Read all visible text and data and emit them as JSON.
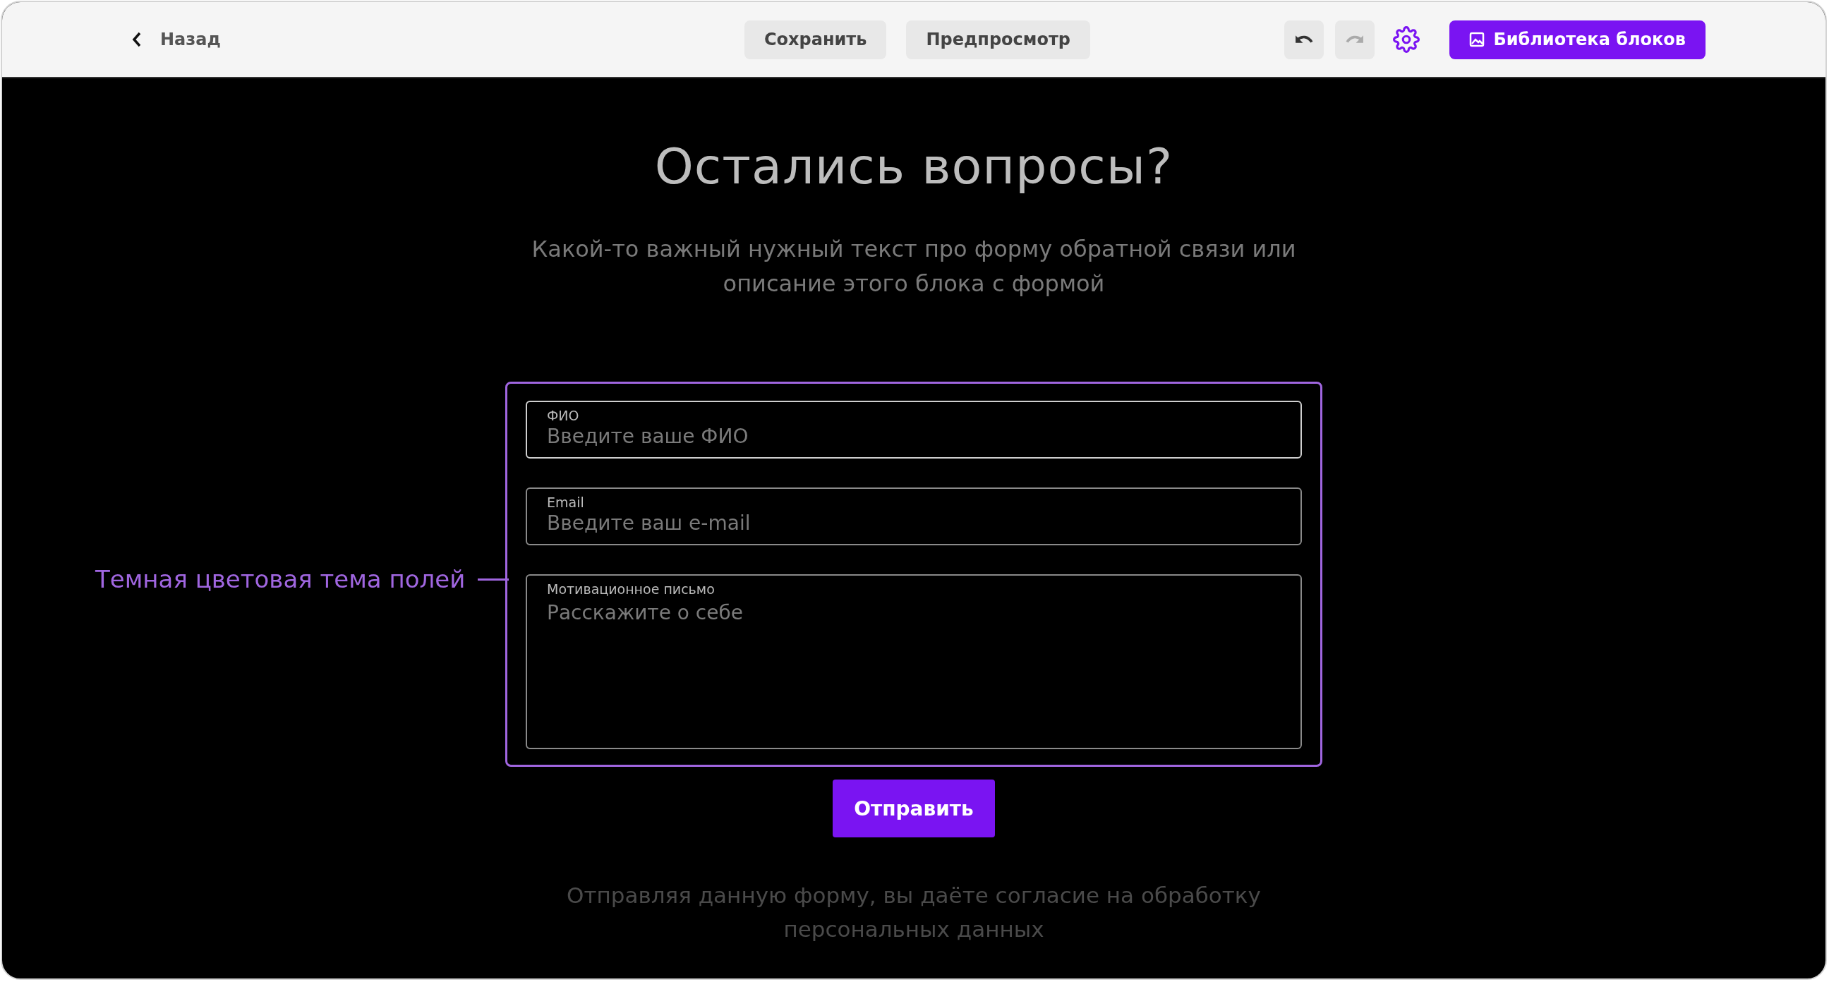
{
  "toolbar": {
    "back": "Назад",
    "buttons": [
      {
        "label": "Сохранить"
      },
      {
        "label": "Предпросмотр"
      }
    ],
    "undo": {
      "disabled": false
    },
    "redo": {
      "disabled": true
    },
    "library": "Библиотека блоков"
  },
  "canvas": {
    "title": "Остались вопросы?",
    "subtitle": "Какой-то важный нужный текст про форму обратной связи или описание этого блока с формой",
    "fields": [
      {
        "kind": "input",
        "label": "ФИО",
        "placeholder": "Введите ваше ФИО",
        "focused": true
      },
      {
        "kind": "input",
        "label": "Email",
        "placeholder": "Введите ваш e-mail",
        "focused": false
      },
      {
        "kind": "textarea",
        "label": "Мотивационное письмо",
        "placeholder": "Расскажите о себе",
        "focused": false
      }
    ],
    "submit": "Отправить",
    "consent": "Отправляя данную форму, вы даёте согласие на обработку персональных данных"
  },
  "annotation": {
    "text": "Темная цветовая тема полей"
  }
}
